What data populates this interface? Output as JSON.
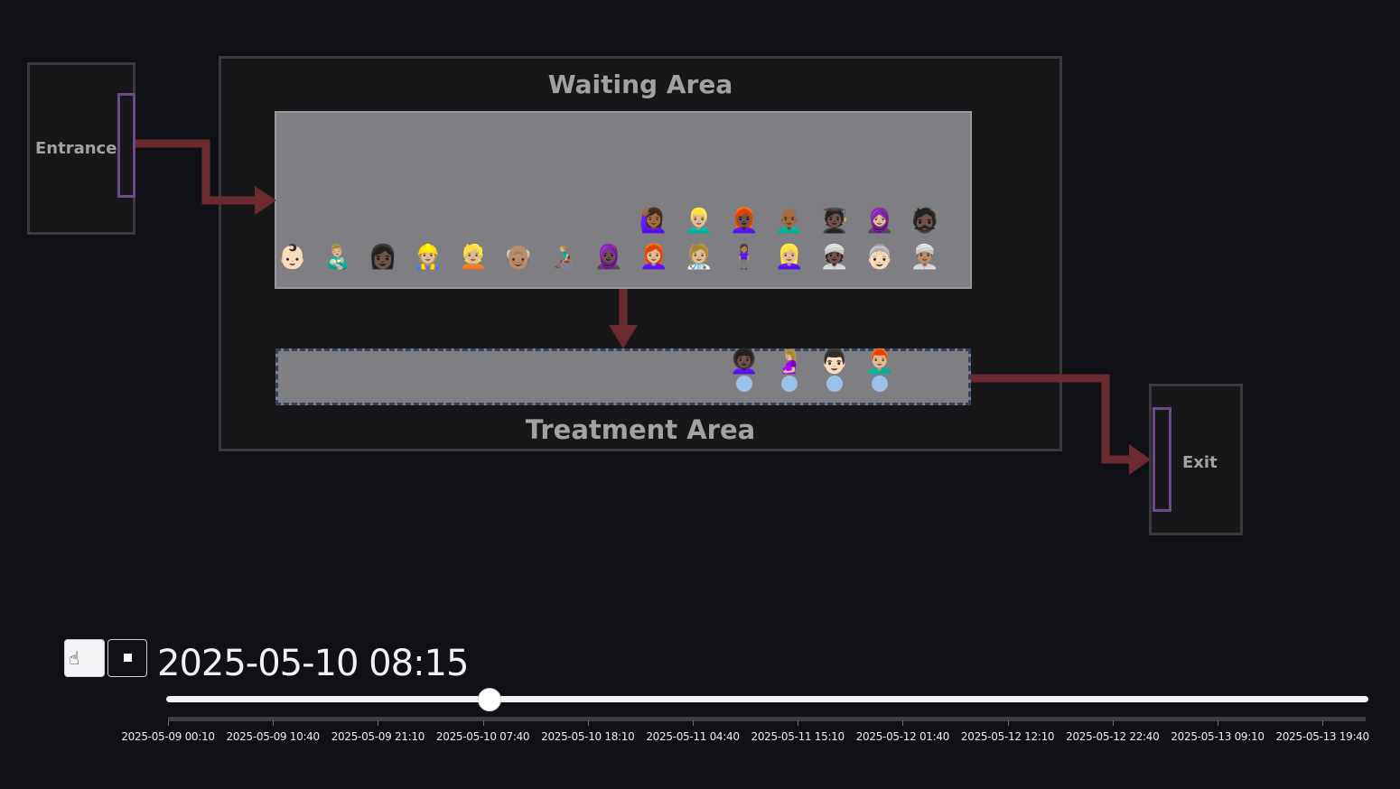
{
  "areas": {
    "entrance": "Entrance",
    "waiting": "Waiting Area",
    "treatment": "Treatment Area",
    "exit": "Exit"
  },
  "colors": {
    "background": "#0f1116",
    "room_fill": "#7f7e82",
    "door": "#6b4a86",
    "arrow": "#6b2a30",
    "seat": "#9cc1e8"
  },
  "waiting_queue": {
    "row_top": [
      "🙋🏾‍♀️",
      "👱🏼‍♂️",
      "👩🏿‍🦰",
      "👨🏾‍🦲",
      "🧑🏿‍🎓",
      "🧕🏼",
      "🧔🏿"
    ],
    "row_bottom": [
      "👶🏻",
      "👨🏼‍🍼",
      "👩🏿",
      "👷🏼",
      "👱🏼",
      "👴🏽",
      "👨🏼‍🦽",
      "🧕🏿",
      "👩🏼‍🦰",
      "🧑🏼‍⚕️",
      "🧍🏽‍♀️",
      "👱🏼‍♀️",
      "👳🏿",
      "👵🏻",
      "👳🏽‍♂️"
    ]
  },
  "treatment_patients": [
    "👩🏿‍🦱",
    "🤰🏼",
    "👨🏻",
    "👨🏼‍🦰"
  ],
  "controls": {
    "play_icon": "play-icon",
    "stop_icon": "stop-icon",
    "current_time": "2025-05-10 08:15",
    "slider_position": 0.269
  },
  "timeline_ticks": [
    "2025-05-09 00:10",
    "2025-05-09 10:40",
    "2025-05-09 21:10",
    "2025-05-10 07:40",
    "2025-05-10 18:10",
    "2025-05-11 04:40",
    "2025-05-11 15:10",
    "2025-05-12 01:40",
    "2025-05-12 12:10",
    "2025-05-12 22:40",
    "2025-05-13 09:10",
    "2025-05-13 19:40"
  ]
}
